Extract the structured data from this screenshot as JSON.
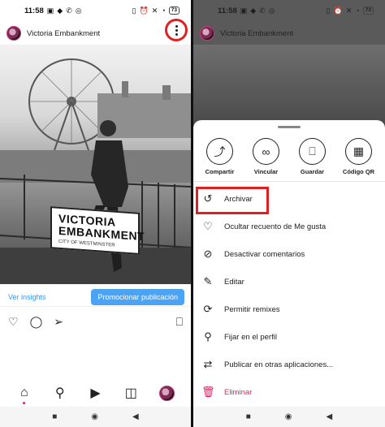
{
  "status_bar": {
    "time": "11:58",
    "battery": "73",
    "left_icons": [
      "chat-icon",
      "game-icon",
      "phone-icon",
      "whatsapp-icon"
    ],
    "right_icons": [
      "vibrate-icon",
      "alarm-icon",
      "mute-icon",
      "wifi-icon"
    ]
  },
  "post": {
    "username": "Victoria Embankment",
    "sign_line1": "VICTORIA",
    "sign_line2": "EMBANKMENT",
    "sign_subtitle": "CITY OF WESTMINSTER"
  },
  "insights": {
    "link_label": "Ver insights",
    "promote_label": "Promocionar publicación"
  },
  "share_actions": [
    {
      "label": "Compartir",
      "icon": "share-icon"
    },
    {
      "label": "Vincular",
      "icon": "link-icon"
    },
    {
      "label": "Guardar",
      "icon": "bookmark-icon"
    },
    {
      "label": "Código QR",
      "icon": "qr-code-icon"
    }
  ],
  "menu": [
    {
      "label": "Archivar",
      "icon": "archive-icon"
    },
    {
      "label": "Ocultar recuento de Me gusta",
      "icon": "heart-off-icon"
    },
    {
      "label": "Desactivar comentarios",
      "icon": "comments-off-icon"
    },
    {
      "label": "Editar",
      "icon": "pencil-icon"
    },
    {
      "label": "Permitir remixes",
      "icon": "remix-icon"
    },
    {
      "label": "Fijar en el perfil",
      "icon": "pin-icon"
    },
    {
      "label": "Publicar en otras aplicaciones...",
      "icon": "repost-icon"
    },
    {
      "label": "Eliminar",
      "icon": "trash-icon"
    }
  ],
  "colors": {
    "accent": "#4aa3f5",
    "highlight": "#e02020",
    "danger": "#e0245e"
  }
}
